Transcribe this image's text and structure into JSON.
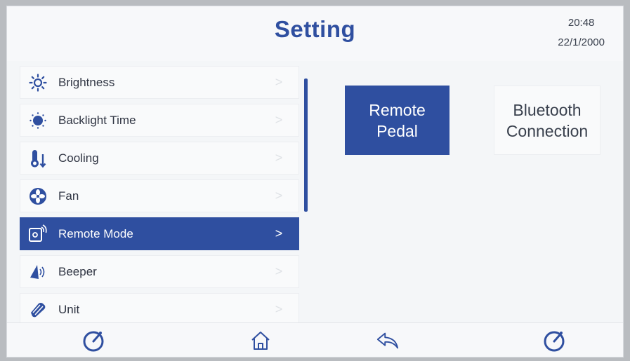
{
  "header": {
    "title": "Setting",
    "time": "20:48",
    "date": "22/1/2000"
  },
  "menu": [
    {
      "label": "Brightness",
      "icon": "brightness-icon",
      "active": false
    },
    {
      "label": "Backlight Time",
      "icon": "backlight-icon",
      "active": false
    },
    {
      "label": "Cooling",
      "icon": "cooling-thermometer-icon",
      "active": false
    },
    {
      "label": "Fan",
      "icon": "fan-icon",
      "active": false
    },
    {
      "label": "Remote Mode",
      "icon": "remote-signal-icon",
      "active": true
    },
    {
      "label": "Beeper",
      "icon": "speaker-icon",
      "active": false
    },
    {
      "label": "Unit",
      "icon": "unit-tag-icon",
      "active": false
    }
  ],
  "chevron": ">",
  "remote_mode": {
    "options": [
      {
        "line1": "Remote",
        "line2": "Pedal",
        "selected": true
      },
      {
        "line1": "Bluetooth",
        "line2": "Connection",
        "selected": false
      }
    ]
  },
  "bottom_nav": [
    "timer-dial-icon",
    "home-icon",
    "back-icon",
    "timer-dial-icon"
  ],
  "colors": {
    "accent": "#2f4fa0",
    "background": "#f4f6f8",
    "text": "#2f3442"
  }
}
